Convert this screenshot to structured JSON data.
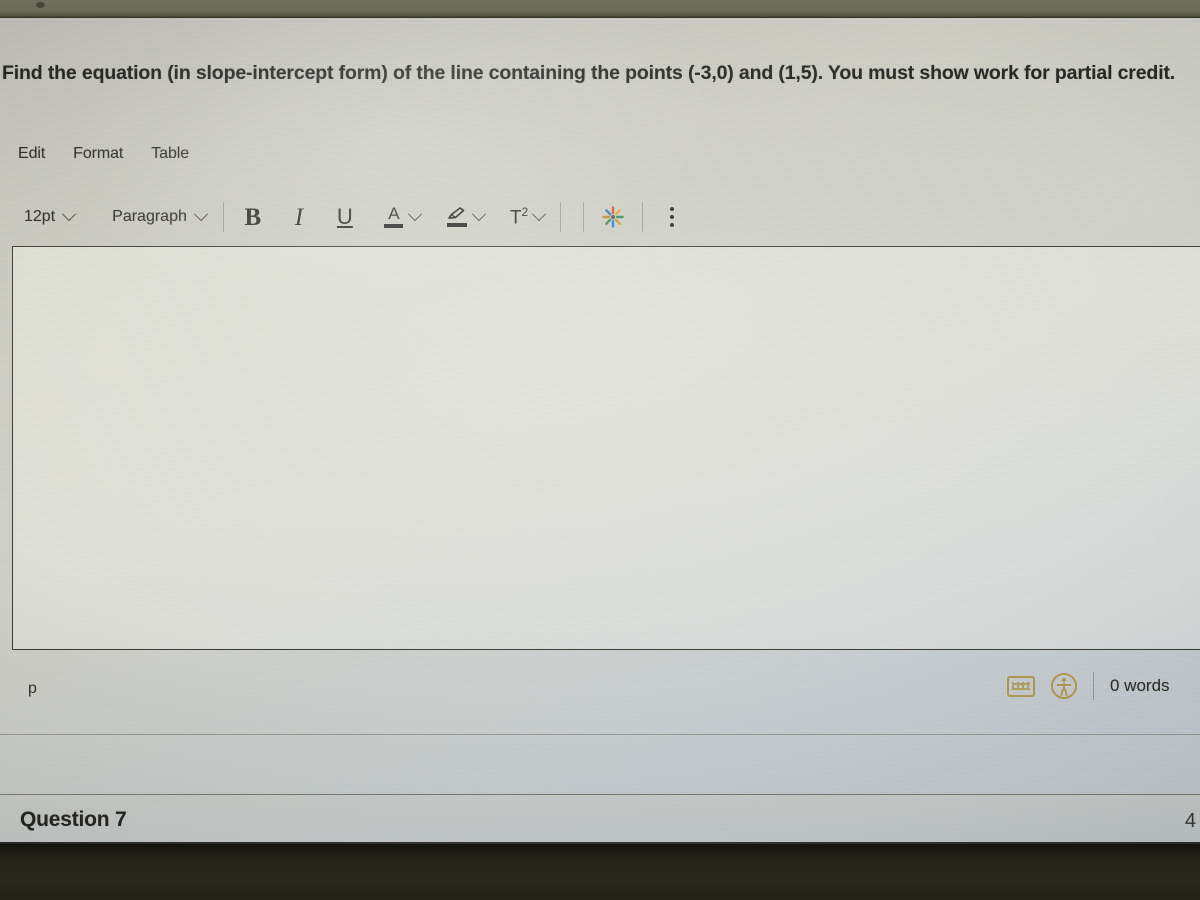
{
  "question": {
    "prompt": "Find the equation (in slope-intercept form) of the line containing the points (-3,0) and (1,5).  You must show work for partial credit.",
    "footer_title": "Question 7",
    "points": "4"
  },
  "menubar": {
    "items": [
      {
        "label": "Edit"
      },
      {
        "label": "Format"
      },
      {
        "label": "Table"
      }
    ]
  },
  "toolbar": {
    "font_size": "12pt",
    "block_format": "Paragraph",
    "bold_label": "B",
    "italic_label": "I",
    "underline_label": "U",
    "text_color_label": "A",
    "superscript_label": "T",
    "superscript_exponent": "2",
    "icons": {
      "font_size_chevron": "chevron-down-icon",
      "block_format_chevron": "chevron-down-icon",
      "text_color": "text-color-icon",
      "highlight": "highlight-pen-icon",
      "superscript": "superscript-icon",
      "apps": "apps-sparkle-icon",
      "overflow": "kebab-menu-icon"
    }
  },
  "editor": {
    "content": "",
    "placeholder": ""
  },
  "statusbar": {
    "path": "p",
    "word_count": "0 words",
    "keyboard_icon": "keyboard-shortcuts-icon",
    "accessibility_icon": "accessibility-checker-icon"
  },
  "colors": {
    "accent_gold": "#b09a4e",
    "text": "#1d1d1b",
    "border": "#33332c",
    "page_bg": "#cdccc5",
    "editor_bg": "#e8e9df",
    "bezel_top": "#6a6b59",
    "bezel_bottom": "#26231a"
  }
}
